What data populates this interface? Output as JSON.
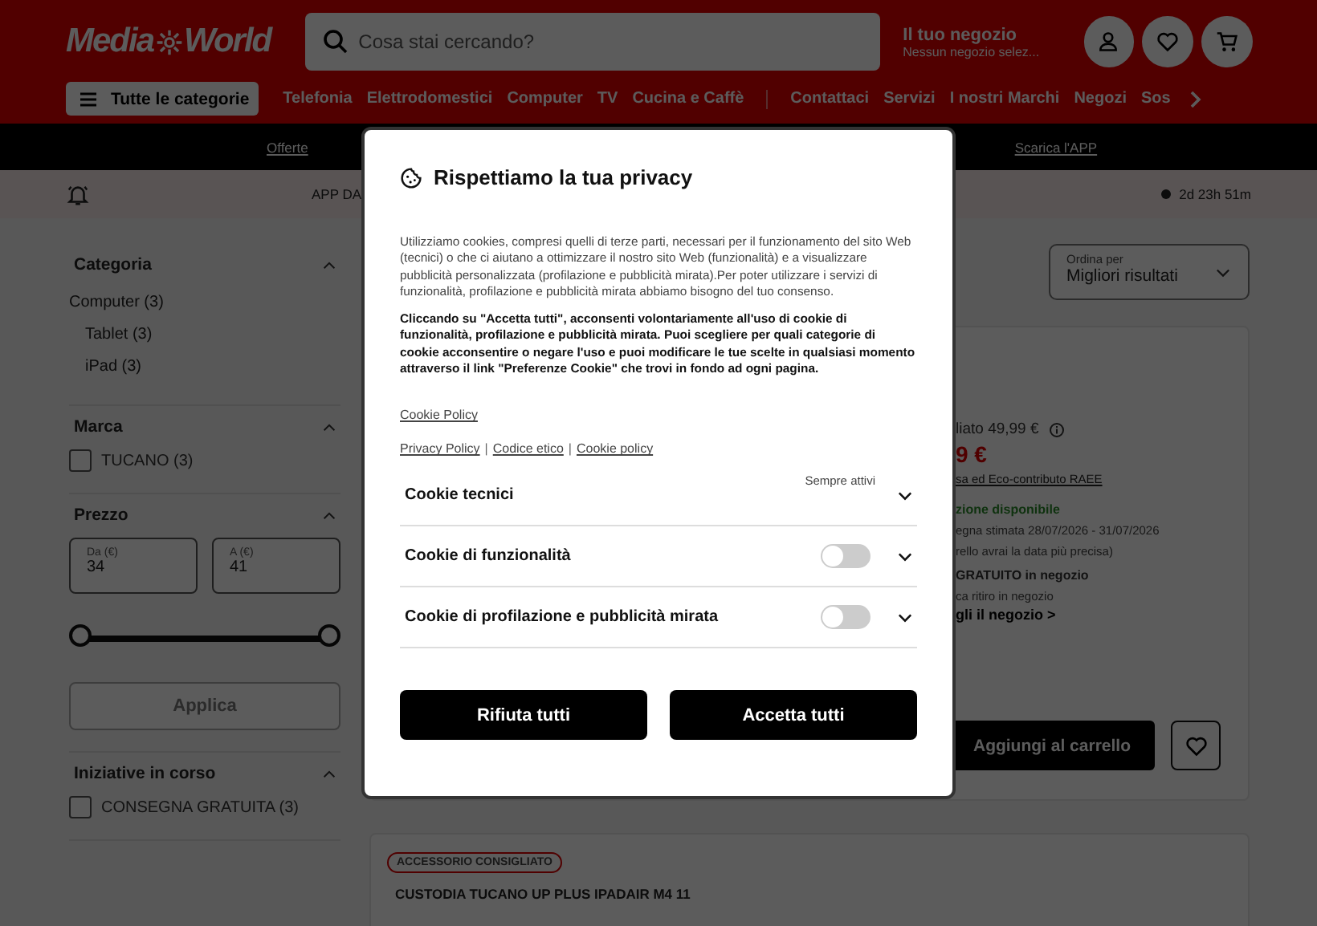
{
  "header": {
    "logo": [
      "Media",
      "World"
    ],
    "search": {
      "placeholder": "Cosa stai cercando?"
    },
    "store": {
      "title": "Il tuo negozio",
      "subtitle": "Nessun negozio selez..."
    },
    "categories_button": "Tutte le categorie",
    "nav_primary": [
      "Telefonia",
      "Elettrodomestici",
      "Computer",
      "TV",
      "Cucina e Caffè"
    ],
    "nav_secondary": [
      "Contattaci",
      "Servizi",
      "I nostri Marchi",
      "Negozi",
      "Sos"
    ]
  },
  "promo_bar": {
    "links": [
      "Offerte",
      "Scarica l'APP"
    ]
  },
  "notice_bar": {
    "text": "APP DA",
    "countdown": "2d 23h 51m"
  },
  "filters": [
    {
      "title": "Categoria",
      "kind": "tree",
      "expanded": true,
      "items": [
        {
          "label": "Computer (3)",
          "children": [
            {
              "label": "Tablet (3)"
            },
            {
              "label": "iPad (3)"
            }
          ]
        }
      ]
    },
    {
      "title": "Marca",
      "kind": "checkbox",
      "expanded": true,
      "items": [
        {
          "label": "TUCANO (3)",
          "checked": false
        }
      ]
    },
    {
      "title": "Prezzo",
      "kind": "price",
      "expanded": true,
      "from": {
        "label": "Da (€)",
        "value": "34"
      },
      "to": {
        "label": "A (€)",
        "value": "41"
      },
      "apply": {
        "label": "Applica",
        "disabled": true
      }
    },
    {
      "title": "Iniziative in corso",
      "kind": "checkbox",
      "expanded": true,
      "items": [
        {
          "label": "CONSEGNA GRATUITA (3)",
          "checked": false
        }
      ]
    }
  ],
  "sort": {
    "label": "Ordina per",
    "value": "Migliori risultati"
  },
  "product": {
    "list_price": "liato 49,99 €",
    "price": "9 €",
    "raee_link": "sa ed Eco-contributo RAEE",
    "availability": "zione disponibile",
    "delivery_date": "egna stimata 28/07/2026 - 31/07/2026",
    "delivery_note": "rello avrai la data più precisa)",
    "pickup": "GRATUITO in negozio",
    "pickup_note": "ca ritiro in negozio",
    "store_link": "gli il negozio >",
    "add_button": "Aggiungi al carrello"
  },
  "accessory": {
    "badge": "ACCESSORIO CONSIGLIATO",
    "title": "CUSTODIA TUCANO UP PLUS IPADAIR M4 11"
  },
  "cookie_dialog": {
    "title": "Rispettiamo la tua privacy",
    "intro": "Utilizziamo cookies, compresi quelli di terze parti, necessari per il funzionamento del sito Web (tecnici) o che ci aiutano a ottimizzare il nostro sito Web (funzionalità) e a visualizzare pubblicità personalizzata (profilazione e pubblicità mirata).Per poter utilizzare i servizi di funzionalità, profilazione e pubblicità mirata abbiamo bisogno del tuo consenso.",
    "consent": "Cliccando su \"Accetta tutti\", acconsenti volontariamente all'uso di cookie di funzionalità, profilazione e pubblicità mirata. Puoi scegliere per quali categorie di cookie acconsentire o negare l'uso e puoi modificare le tue scelte in qualsiasi momento attraverso il link \"Preferenze Cookie\" che trovi in fondo ad ogni pagina.",
    "policy_link": "Cookie Policy",
    "legal_links": [
      {
        "kind": "link",
        "label": "Privacy Policy"
      },
      {
        "kind": "separator",
        "label": "|"
      },
      {
        "kind": "link",
        "label": "Codice etico"
      },
      {
        "kind": "separator",
        "label": "|"
      },
      {
        "kind": "link",
        "label": "Cookie policy"
      }
    ],
    "categories": [
      {
        "label": "Cookie tecnici",
        "kind": "always",
        "status": "Sempre attivi"
      },
      {
        "label": "Cookie di funzionalità",
        "kind": "toggle",
        "on": false
      },
      {
        "label": "Cookie di profilazione e pubblicità mirata",
        "kind": "toggle",
        "on": false
      }
    ],
    "buttons": [
      "Rifiuta tutti",
      "Accetta tutti"
    ]
  }
}
